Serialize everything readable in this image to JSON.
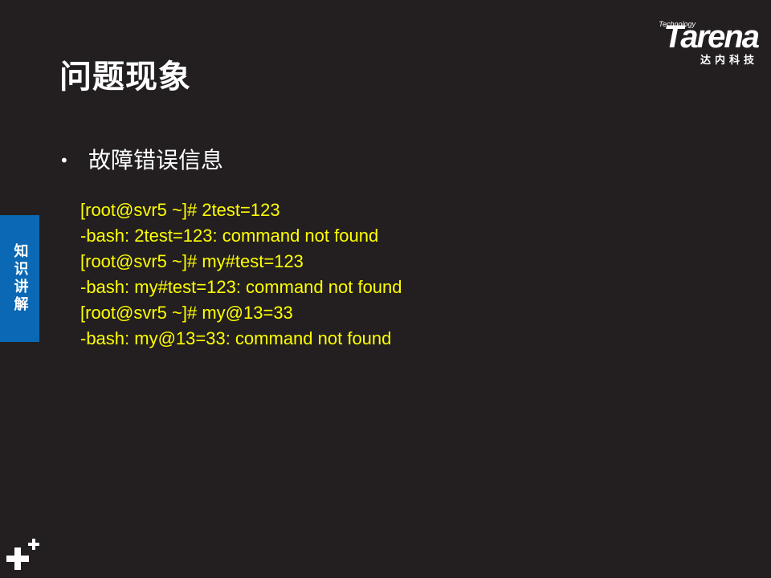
{
  "slide": {
    "title": "问题现象",
    "bullet": "故障错误信息",
    "code_lines": [
      "[root@svr5 ~]# 2test=123",
      "-bash: 2test=123: command not found",
      "[root@svr5 ~]# my#test=123",
      "-bash: my#test=123: command not found",
      "[root@svr5 ~]# my@13=33",
      "-bash: my@13=33: command not found"
    ],
    "side_tab": "知识讲解"
  },
  "logo": {
    "word": "Tarena",
    "tagline": "Technology",
    "cn": "达内科技"
  },
  "colors": {
    "background": "#231f20",
    "code_text": "#ffff00",
    "side_tab": "#0a68b4",
    "text": "#ffffff"
  },
  "icons": {
    "bullet": "•",
    "corner": "plus-icon"
  }
}
